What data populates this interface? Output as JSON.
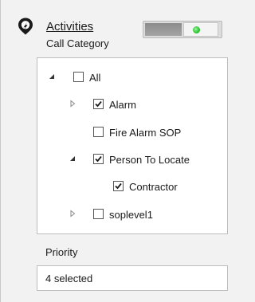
{
  "header": {
    "icon": "location-pin-icon",
    "title": "Activities",
    "subtitle": "Call Category",
    "toggle": {
      "on": true,
      "indicator_color": "#22c02a"
    }
  },
  "tree": {
    "items": [
      {
        "label": "All",
        "checked": false,
        "expander": "expanded"
      },
      {
        "label": "Alarm",
        "checked": true,
        "expander": "collapsed"
      },
      {
        "label": "Fire Alarm SOP",
        "checked": false,
        "expander": "none"
      },
      {
        "label": "Person To Locate",
        "checked": true,
        "expander": "expanded"
      },
      {
        "label": "Contractor",
        "checked": true,
        "expander": "none"
      },
      {
        "label": "soplevel1",
        "checked": false,
        "expander": "collapsed"
      }
    ]
  },
  "priority": {
    "label": "Priority",
    "value": "4 selected"
  }
}
